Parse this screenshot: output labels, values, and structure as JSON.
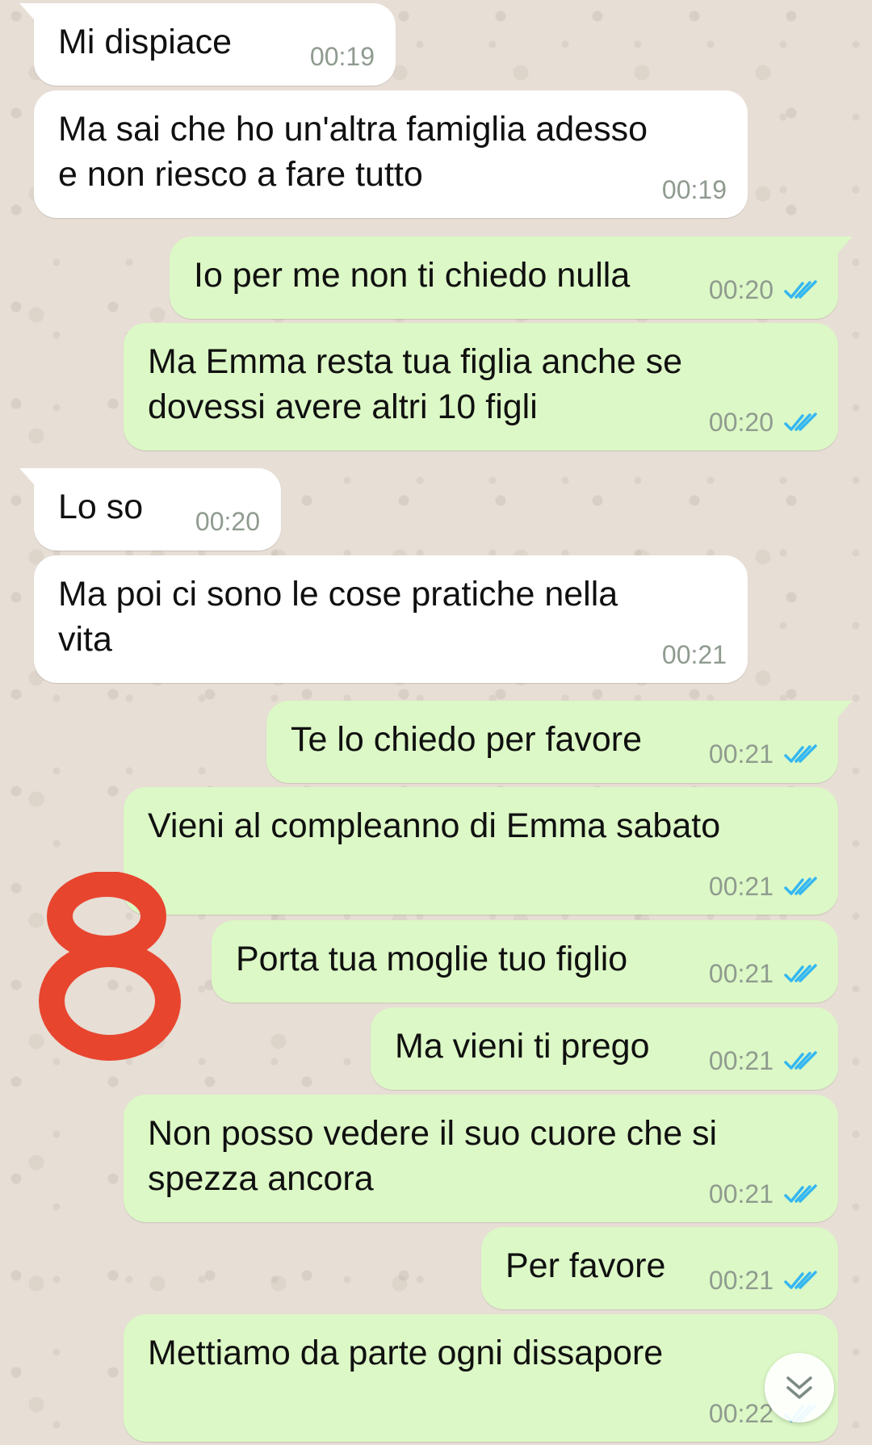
{
  "messages": [
    {
      "direction": "in",
      "text": "Mi dispiace",
      "time": "00:19"
    },
    {
      "direction": "in",
      "text": "Ma sai che ho un'altra famiglia adesso\ne non riesco a fare tutto",
      "time": "00:19"
    },
    {
      "direction": "out",
      "text": "Io per me non ti chiedo nulla",
      "time": "00:20",
      "status": "read"
    },
    {
      "direction": "out",
      "text": "Ma Emma resta tua figlia anche se\ndovessi avere altri 10 figli",
      "time": "00:20",
      "status": "read"
    },
    {
      "direction": "in",
      "text": "Lo so",
      "time": "00:20"
    },
    {
      "direction": "in",
      "text": "Ma poi ci sono le cose pratiche nella\nvita",
      "time": "00:21"
    },
    {
      "direction": "out",
      "text": "Te lo chiedo per favore",
      "time": "00:21",
      "status": "read"
    },
    {
      "direction": "out",
      "text": "Vieni al compleanno di Emma sabato",
      "time": "00:21",
      "status": "read"
    },
    {
      "direction": "out",
      "text": "Porta tua moglie tuo figlio",
      "time": "00:21",
      "status": "read"
    },
    {
      "direction": "out",
      "text": "Ma vieni ti prego",
      "time": "00:21",
      "status": "read"
    },
    {
      "direction": "out",
      "text": "Non posso vedere il suo cuore che si\nspezza ancora",
      "time": "00:21",
      "status": "read"
    },
    {
      "direction": "out",
      "text": "Per favore",
      "time": "00:21",
      "status": "read"
    },
    {
      "direction": "out",
      "text": "Mettiamo da parte ogni dissapore",
      "time": "00:22",
      "status": "read"
    }
  ],
  "annotation": {
    "label": "8",
    "color": "#e8452f"
  },
  "colors": {
    "incoming_bubble": "#ffffff",
    "outgoing_bubble": "#dcf8c6",
    "read_ticks": "#34b7f1",
    "wallpaper": "#e7ded5"
  },
  "icons": {
    "read_receipt": "double-check-icon",
    "scroll_down": "chevron-double-down-icon"
  }
}
